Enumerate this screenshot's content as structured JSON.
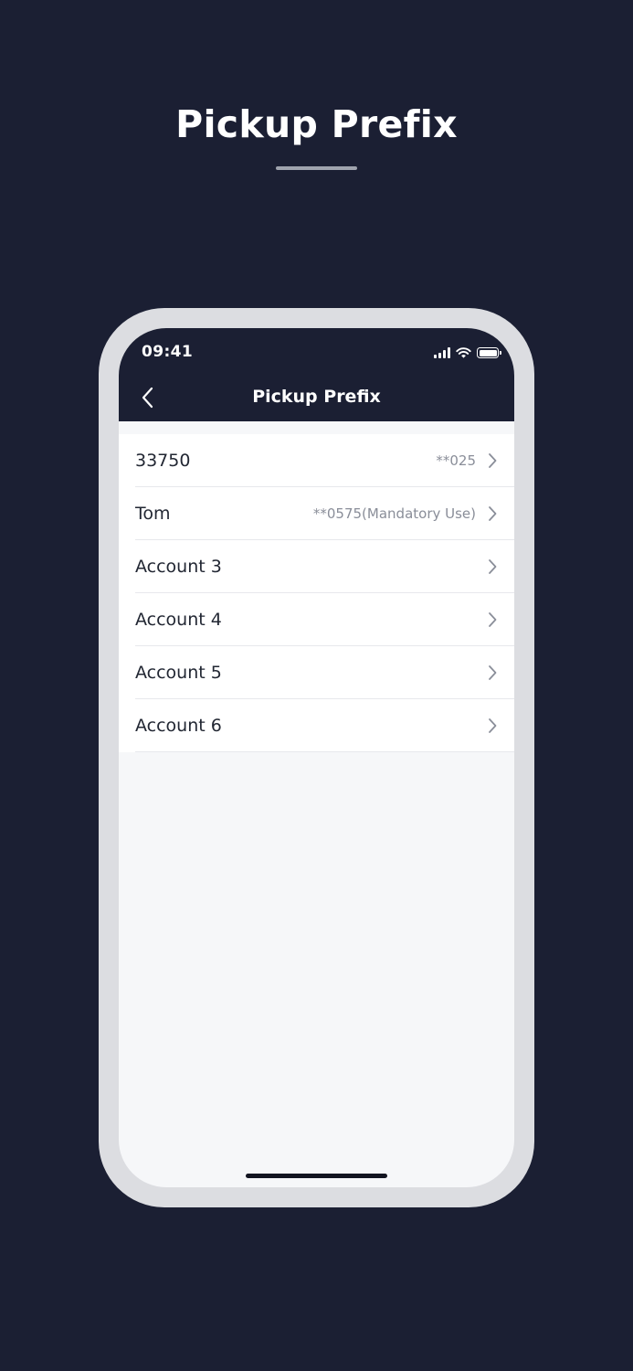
{
  "promo": {
    "title": "Pickup Prefix"
  },
  "status_bar": {
    "time": "09:41",
    "icons": [
      "signal-icon",
      "wifi-icon",
      "battery-icon"
    ]
  },
  "nav": {
    "title": "Pickup Prefix",
    "back_icon": "chevron-left-icon"
  },
  "accounts": [
    {
      "label": "33750",
      "value": "**025"
    },
    {
      "label": "Tom",
      "value": "**0575(Mandatory Use)"
    },
    {
      "label": "Account 3",
      "value": ""
    },
    {
      "label": "Account 4",
      "value": ""
    },
    {
      "label": "Account 5",
      "value": ""
    },
    {
      "label": "Account 6",
      "value": ""
    }
  ],
  "colors": {
    "background": "#1b1f33",
    "header": "#1b1f33",
    "list_background": "#ffffff",
    "screen_background": "#f6f7f9",
    "primary_text": "#222733",
    "secondary_text": "#8a8e99",
    "chevron": "#8a8e99"
  }
}
